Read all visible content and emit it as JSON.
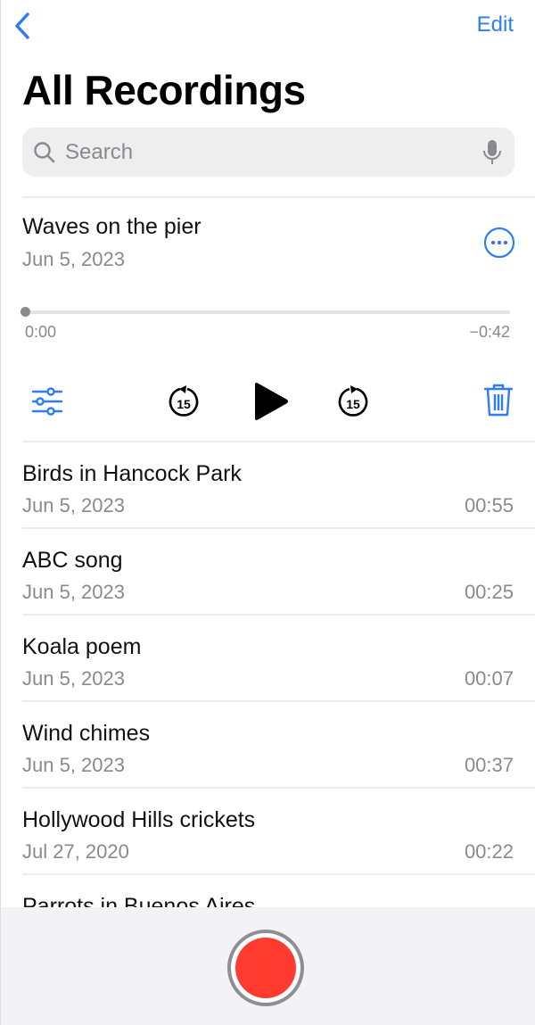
{
  "nav": {
    "back_label": "Back",
    "edit_label": "Edit"
  },
  "header": {
    "title": "All Recordings"
  },
  "search": {
    "placeholder": "Search",
    "value": ""
  },
  "expanded": {
    "title": "Waves on the pier",
    "date": "Jun 5, 2023",
    "elapsed": "0:00",
    "remaining": "−0:42",
    "progress": 0,
    "skip_back_seconds": "15",
    "skip_forward_seconds": "15"
  },
  "recordings": [
    {
      "name": "Birds in Hancock Park",
      "date": "Jun 5, 2023",
      "duration": "00:55"
    },
    {
      "name": "ABC song",
      "date": "Jun 5, 2023",
      "duration": "00:25"
    },
    {
      "name": "Koala poem",
      "date": "Jun 5, 2023",
      "duration": "00:07"
    },
    {
      "name": "Wind chimes",
      "date": "Jun 5, 2023",
      "duration": "00:37"
    },
    {
      "name": "Hollywood Hills crickets",
      "date": "Jul 27, 2020",
      "duration": "00:22"
    },
    {
      "name": "Parrots in Buenos Aires",
      "date": "",
      "duration": ""
    }
  ],
  "colors": {
    "accent": "#2f7cf6",
    "record": "#ff3b30",
    "secondary_text": "#8a8a8e"
  }
}
